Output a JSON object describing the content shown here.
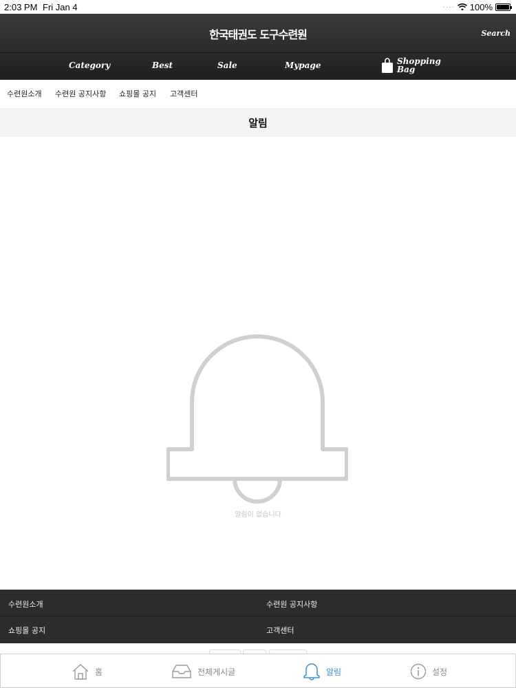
{
  "status_bar": {
    "time": "2:03 PM",
    "date": "Fri Jan 4",
    "battery": "100%",
    "battery_level": 1.0
  },
  "header": {
    "site_title": "한국태권도 도구수련원",
    "search_label": "Search",
    "nav": [
      "Category",
      "Best",
      "Sale",
      "Mypage"
    ],
    "shopping_bag_label": "Shopping Bag",
    "icons": {
      "bag": "shopping-bag-icon"
    }
  },
  "submenu": [
    "수련원소개",
    "수련원 공지사항",
    "쇼핑몰 공지",
    "고객센터"
  ],
  "page_title": "알림",
  "empty_state": {
    "message": "알림이 없습니다",
    "icon": "bell-icon",
    "icon_color": "#cfcfcf"
  },
  "footer_links": [
    "수련원소개",
    "수련원 공지사항",
    "쇼핑몰 공지",
    "고객센터"
  ],
  "tab_bar": {
    "items": [
      {
        "label": "홈",
        "icon": "home-icon"
      },
      {
        "label": "전체게시글",
        "icon": "inbox-icon"
      },
      {
        "label": "알림",
        "icon": "bell-icon"
      },
      {
        "label": "설정",
        "icon": "info-icon"
      }
    ],
    "active_index": 2,
    "active_color": "#3a8fd6"
  }
}
